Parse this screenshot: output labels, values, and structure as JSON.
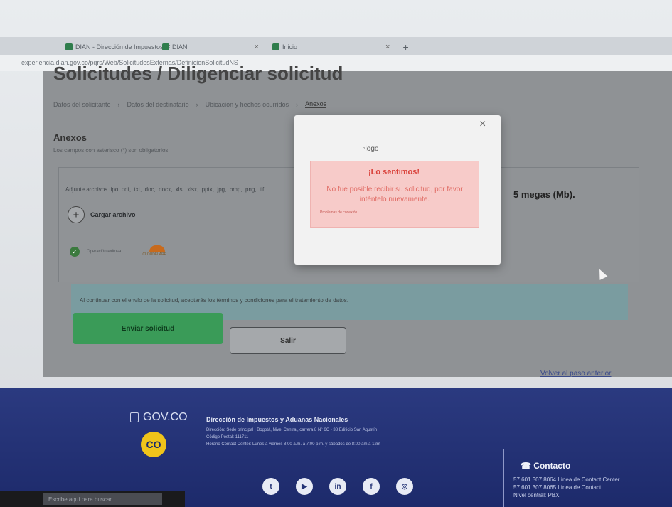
{
  "browser": {
    "tabs": [
      {
        "label": "DIAN - Dirección de Impuestos"
      },
      {
        "label": "DIAN"
      },
      {
        "label": "Inicio"
      }
    ],
    "new_tab": "+",
    "url": "experiencia.dian.gov.co/pqrs/Web/SolicitudesExternas/DefinicionSolicitudNS"
  },
  "page": {
    "title": "Solicitudes / Diligenciar solicitud",
    "breadcrumb": [
      "Datos del solicitante",
      "Datos del destinatario",
      "Ubicación y hechos ocurridos",
      "Anexos"
    ],
    "section_title": "Anexos",
    "section_sub": "Los campos con asterisco (*) son obligatorios.",
    "allowed_types": "Adjunte archivos tipo .pdf, .txt, .doc, .docx, .xls, .xlsx, .pptx, .jpg, .bmp, .png, .tif,",
    "size_limit": "5 megas (Mb).",
    "upload_label": "Cargar archivo",
    "captcha_label": "Operación exitosa",
    "captcha_brand": "CLOUDFLARE",
    "notice": "Al continuar con el envío de la solicitud, aceptarás los términos y condiciones para el tratamiento de datos.",
    "send_button": "Enviar solicitud",
    "exit_button": "Salir",
    "back_link": "Volver al paso anterior"
  },
  "modal": {
    "close": "×",
    "logo_alt": "logo",
    "title": "¡Lo sentimos!",
    "message": "No fue posible recibir su solicitud, por favor inténtelo nuevamente.",
    "small": "Problemas de conexión"
  },
  "footer": {
    "gov": "GOV.CO",
    "co_badge": "CO",
    "org_title": "Dirección de Impuestos y Aduanas Nacionales",
    "lines": [
      "Dirección: Sede principal | Bogotá, Nivel Central, carrera 8 N° 6C - 38 Edificio San Agustín",
      "Código Postal: 111711",
      "Horario Contact Center: Lunes a viernes 8:00 a.m. a 7:00 p.m. y sábados de 8:00 am a 12m"
    ],
    "contact_title": "Contacto",
    "contact_lines": [
      "57 601 307 8064 Línea de Contact Center",
      "57 601 307 8065 Línea de Contact",
      "Nivel central: PBX"
    ],
    "social": [
      "twitter-icon",
      "youtube-icon",
      "linkedin-icon",
      "facebook-icon",
      "instagram-icon"
    ]
  },
  "taskbar": {
    "search_placeholder": "Escribe aquí para buscar"
  }
}
